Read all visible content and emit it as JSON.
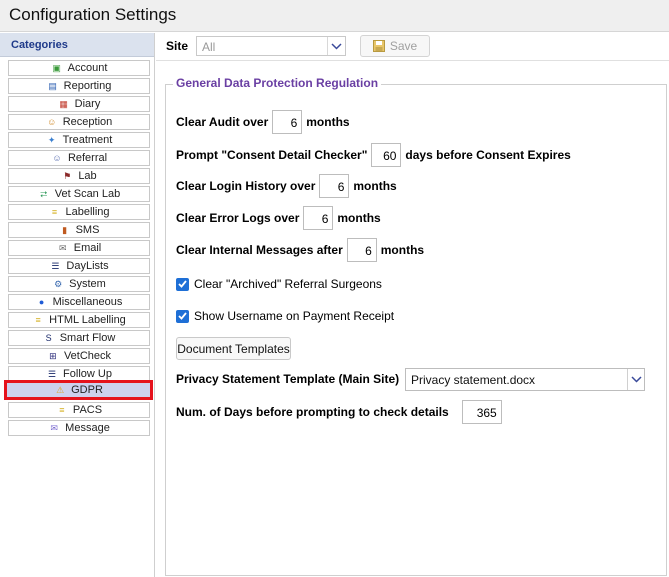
{
  "window": {
    "title": "Configuration Settings"
  },
  "sidebar": {
    "header": "Categories",
    "items": [
      {
        "label": "Account",
        "icon": "account-icon",
        "color": "#3a9a3a"
      },
      {
        "label": "Reporting",
        "icon": "reporting-icon",
        "color": "#2a5db0"
      },
      {
        "label": "Diary",
        "icon": "diary-icon",
        "color": "#c0392b"
      },
      {
        "label": "Reception",
        "icon": "reception-icon",
        "color": "#d08a2a"
      },
      {
        "label": "Treatment",
        "icon": "treatment-icon",
        "color": "#3a7fd0"
      },
      {
        "label": "Referral",
        "icon": "referral-icon",
        "color": "#5a6fb0"
      },
      {
        "label": "Lab",
        "icon": "lab-icon",
        "color": "#8b2a2a"
      },
      {
        "label": "Vet Scan Lab",
        "icon": "vet-scan-lab-icon",
        "color": "#2e9a5a"
      },
      {
        "label": "Labelling",
        "icon": "labelling-icon",
        "color": "#d4b020"
      },
      {
        "label": "SMS",
        "icon": "sms-icon",
        "color": "#c05a20"
      },
      {
        "label": "Email",
        "icon": "email-icon",
        "color": "#6a6a6a"
      },
      {
        "label": "DayLists",
        "icon": "daylists-icon",
        "color": "#1a2a6a"
      },
      {
        "label": "System",
        "icon": "system-icon",
        "color": "#3a6ab0"
      },
      {
        "label": "Miscellaneous",
        "icon": "miscellaneous-icon",
        "color": "#1e5bd6"
      },
      {
        "label": "HTML Labelling",
        "icon": "html-labelling-icon",
        "color": "#d4b020"
      },
      {
        "label": "Smart Flow",
        "icon": "smart-flow-icon",
        "color": "#1a2a6a"
      },
      {
        "label": "VetCheck",
        "icon": "vetcheck-icon",
        "color": "#2a2a7a"
      },
      {
        "label": "Follow Up",
        "icon": "follow-up-icon",
        "color": "#1a2a6a"
      },
      {
        "label": "GDPR",
        "icon": "gdpr-icon",
        "color": "#e0a020"
      },
      {
        "label": "PACS",
        "icon": "pacs-icon",
        "color": "#d4b020"
      },
      {
        "label": "Message",
        "icon": "message-icon",
        "color": "#7a6ad0"
      }
    ],
    "selected_index": 18
  },
  "toolbar": {
    "site_label": "Site",
    "site_value": "All",
    "save_label": "Save"
  },
  "gdpr": {
    "legend": "General Data Protection Regulation",
    "clear_audit": {
      "prefix": "Clear Audit over",
      "value": "6",
      "suffix": "months"
    },
    "consent_checker": {
      "prefix": "Prompt \"Consent Detail Checker\"",
      "value": "60",
      "suffix": "days before Consent Expires"
    },
    "clear_login": {
      "prefix": "Clear Login History over",
      "value": "6",
      "suffix": "months"
    },
    "clear_errors": {
      "prefix": "Clear Error Logs over",
      "value": "6",
      "suffix": "months"
    },
    "clear_messages": {
      "prefix": "Clear Internal Messages after",
      "value": "6",
      "suffix": "months"
    },
    "clear_archived": {
      "label": "Clear \"Archived\" Referral Surgeons",
      "checked": true
    },
    "show_username": {
      "label": "Show Username on Payment Receipt",
      "checked": true
    },
    "document_templates_label": "Document Templates",
    "privacy_template": {
      "label": "Privacy Statement Template (Main Site)",
      "value": "Privacy statement.docx"
    },
    "days_prompting": {
      "label": "Num. of Days before prompting to check details",
      "value": "365"
    }
  },
  "colors": {
    "accent": "#1e6fd6",
    "legend": "#6a3fa3",
    "selection_border": "#e5121c",
    "selection_fill": "#cdd1ee"
  }
}
